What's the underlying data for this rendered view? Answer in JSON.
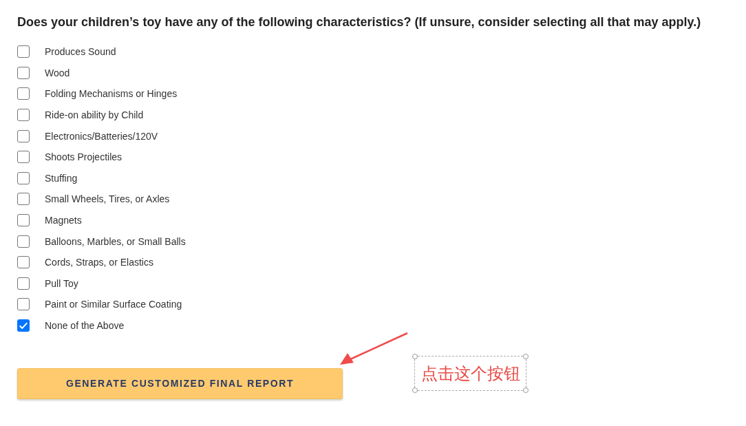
{
  "question": "Does your children’s toy have any of the following characteristics? (If unsure, consider selecting all that may apply.)",
  "options": [
    {
      "label": "Produces Sound",
      "checked": false
    },
    {
      "label": "Wood",
      "checked": false
    },
    {
      "label": "Folding Mechanisms or Hinges",
      "checked": false
    },
    {
      "label": "Ride-on ability by Child",
      "checked": false
    },
    {
      "label": "Electronics/Batteries/120V",
      "checked": false
    },
    {
      "label": "Shoots Projectiles",
      "checked": false
    },
    {
      "label": "Stuffing",
      "checked": false
    },
    {
      "label": "Small Wheels, Tires, or Axles",
      "checked": false
    },
    {
      "label": "Magnets",
      "checked": false
    },
    {
      "label": "Balloons, Marbles, or Small Balls",
      "checked": false
    },
    {
      "label": "Cords, Straps, or Elastics",
      "checked": false
    },
    {
      "label": "Pull Toy",
      "checked": false
    },
    {
      "label": "Paint or Similar Surface Coating",
      "checked": false
    },
    {
      "label": "None of the Above",
      "checked": true
    }
  ],
  "button": {
    "label": "GENERATE CUSTOMIZED FINAL REPORT"
  },
  "annotation": {
    "text": "点击这个按钮"
  }
}
